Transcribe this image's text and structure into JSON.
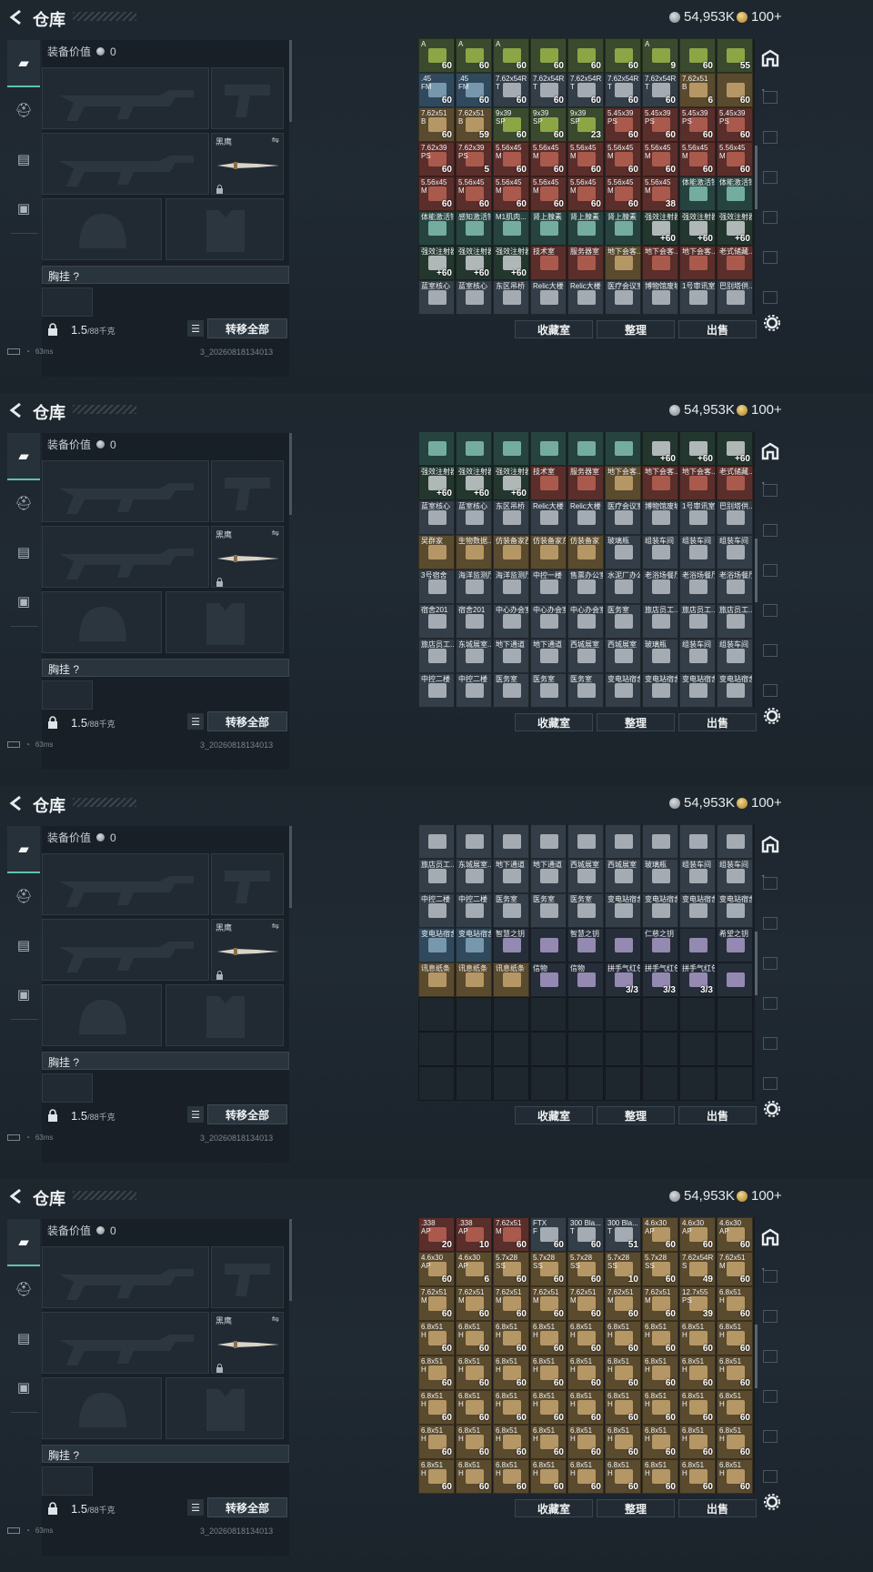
{
  "header": {
    "title": "仓库",
    "silver": "54,953K",
    "gold": "100+"
  },
  "loadout": {
    "value_label": "装备价值",
    "value": "0",
    "knife_label": "黑鹰",
    "chest_label": "胸挂 ?",
    "weight": "1.5",
    "weight_max": "/88千克",
    "move_all": "转移全部"
  },
  "buttons": {
    "collection": "收藏室",
    "organize": "整理",
    "sell": "出售"
  },
  "status": {
    "ping": "63ms",
    "build": "3_20260818134013"
  },
  "colors": {
    "ammo_blue": "#3a5b72",
    "ammo_tan": "#6b5a3a",
    "med_teal": "#2e5a52",
    "key_red": "#6b2a2e",
    "key_blue": "#2e3e6a",
    "key_tan": "#6a5634",
    "grey": "#3e4a55",
    "accent": "#5fc3a8"
  },
  "panels": [
    {
      "cells": [
        [
          "A|60|green",
          "A|60|green",
          "A|60|green",
          "|60|green",
          "|60|green",
          "|60|green",
          "A|9|green",
          "|60|green",
          "|55|green"
        ],
        [
          ".45\nFM|60|blue",
          ".45\nFM|60|blue",
          "7.62x54R\nT|60|grey",
          "7.62x54R\nT|60|grey",
          "7.62x54R\nT|60|grey",
          "7.62x54R\nT|60|grey",
          "7.62x54R\nT|60|grey",
          "7.62x51\nB|6|tan",
          "|60|tan"
        ],
        [
          "7.62x51\nB|60|tan",
          "7.62x51\nB|59|tan",
          "9x39\nSP|60|green",
          "9x39\nSP|60|green",
          "9x39\nSP|23|green",
          "5.45x39\nPS|60|red",
          "5.45x39\nPS|60|red",
          "5.45x39\nPS|60|red",
          "5.45x39\nPS|60|red"
        ],
        [
          "7.62x39\nPS|60|red",
          "7.62x39\nPS|5|red",
          "5.56x45\nM|60|red",
          "5.56x45\nM|60|red",
          "5.56x45\nM|60|red",
          "5.56x45\nM|60|red",
          "5.56x45\nM|60|red",
          "5.56x45\nM|60|red",
          "5.56x45\nM|60|red"
        ],
        [
          "5.56x45\nM|60|red",
          "5.56x45\nM|60|red",
          "5.56x45\nM|60|red",
          "5.56x45\nM|60|red",
          "5.56x45\nM|60|red",
          "5.56x45\nM|60|red",
          "5.56x45\nM|38|red",
          "体能激活针||teal",
          "体能激活针||teal"
        ],
        [
          "体能激活针||teal",
          "感知激活针||teal",
          "M1肌肉...||teal",
          "肾上腺素||teal",
          "肾上腺素||teal",
          "肾上腺素||teal",
          "强效注射器|+60|med",
          "强效注射器|+60|med",
          "强效注射器|+60|med"
        ],
        [
          "强效注射器|+60|med",
          "强效注射器|+60|med",
          "强效注射器|+60|med",
          "技术室||red",
          "服务器室||red",
          "地下会客...||tan",
          "地下会客...||red",
          "地下会客...||red",
          "老式储藏...||red"
        ],
        [
          "蓝室核心||grey",
          "蓝室核心||grey",
          "东区吊桥||grey",
          "Relic大楼||grey",
          "Relic大楼||grey",
          "医疗会议室||grey",
          "博物馆废墟||grey",
          "1号审讯室||grey",
          "巴别塔供...||grey"
        ]
      ]
    },
    {
      "cells": [
        [
          "||teal",
          "||teal",
          "||teal",
          "||teal",
          "||teal",
          "||teal",
          "|+60|med",
          "|+60|med",
          "|+60|med"
        ],
        [
          "强效注射器|+60|med",
          "强效注射器|+60|med",
          "强效注射器|+60|med",
          "技术室||red",
          "服务器室||red",
          "地下会客...||tan",
          "地下会客...||red",
          "地下会客...||red",
          "老式储藏...||red"
        ],
        [
          "蓝室核心||grey",
          "蓝室核心||grey",
          "东区吊桥||grey",
          "Relic大楼||grey",
          "Relic大楼||grey",
          "医疗会议室||grey",
          "博物馆废墟||grey",
          "1号审讯室||grey",
          "巴别塔供...||grey"
        ],
        [
          "吴群家||tan",
          "生物数据...||tan",
          "仿装备家西||tan",
          "仿装备家东||tan",
          "仿装备家||tan",
          "玻璃瓶||grey",
          "组装车间||grey",
          "组装车间||grey",
          "组装车间||grey"
        ],
        [
          "3号宿舍||grey",
          "海洋监测厅||grey",
          "海洋监测厅||grey",
          "中控一楼||grey",
          "售票办公室||grey",
          "水泥厂办公||grey",
          "老浴场餐厅||grey",
          "老浴场餐厅||grey",
          "老浴场餐厅||grey"
        ],
        [
          "宿舍201||grey",
          "宿舍201||grey",
          "中心办会室||grey",
          "中心办会室||grey",
          "中心办会室||grey",
          "医务室||grey",
          "旅店员工...||grey",
          "旅店员工...||grey",
          "旅店员工...||grey"
        ],
        [
          "旅店员工...||grey",
          "东城展室...||grey",
          "地下通道||grey",
          "地下通道||grey",
          "西城展室||grey",
          "西城展室||grey",
          "玻璃瓶||grey",
          "组装车间||grey",
          "组装车间||grey"
        ],
        [
          "中控二楼||grey",
          "中控二楼||grey",
          "医务室||grey",
          "医务室||grey",
          "医务室||grey",
          "变电站宿舍||grey",
          "变电站宿舍||grey",
          "变电站宿舍||grey",
          "变电站宿舍||grey"
        ]
      ]
    },
    {
      "cells": [
        [
          "||grey",
          "||grey",
          "||grey",
          "||grey",
          "||grey",
          "||grey",
          "||grey",
          "||grey",
          "||grey"
        ],
        [
          "旅店员工...||grey",
          "东城展室...||grey",
          "地下通道||grey",
          "地下通道||grey",
          "西城展室||grey",
          "西城展室||grey",
          "玻璃瓶||grey",
          "组装车间||grey",
          "组装车间||grey"
        ],
        [
          "中控二楼||grey",
          "中控二楼||grey",
          "医务室||grey",
          "医务室||grey",
          "医务室||grey",
          "变电站宿舍||grey",
          "变电站宿舍||grey",
          "变电站宿舍||grey",
          "变电站宿舍||grey"
        ],
        [
          "变电站宿舍||blue",
          "变电站宿舍||blue",
          "智慧之钥||dark",
          "||dark",
          "智慧之钥||dark",
          "||dark",
          "仁慈之钥||dark",
          "||dark",
          "希望之钥||dark"
        ],
        [
          "讯息纸条||tan",
          "讯息纸条||tan",
          "讯息纸条||tan",
          "信物||dark",
          "信物||dark",
          "拼手气红包|3/3|dark",
          "拼手气红包|3/3|dark",
          "拼手气红包|3/3|dark",
          "||dark"
        ],
        [
          "||empty",
          "||empty",
          "||empty",
          "||empty",
          "||empty",
          "||empty",
          "||empty",
          "||empty",
          "||empty"
        ],
        [
          "||empty",
          "||empty",
          "||empty",
          "||empty",
          "||empty",
          "||empty",
          "||empty",
          "||empty",
          "||empty"
        ],
        [
          "||empty",
          "||empty",
          "||empty",
          "||empty",
          "||empty",
          "||empty",
          "||empty",
          "||empty",
          "||empty"
        ]
      ]
    },
    {
      "cells": [
        [
          ".338\nAP|20|red",
          ".338\nAP|10|red",
          "7.62x51\nM|60|red",
          "FTX\nF|60|grey",
          "300 Bla...\nT|60|grey",
          "300 Bla...\nT|51|grey",
          "4.6x30\nAP|60|tan",
          "4.6x30\nAP|60|tan",
          "4.6x30\nAP|60|tan"
        ],
        [
          "4.6x30\nAP|60|tan",
          "4.6x30\nAP|6|tan",
          "5.7x28\nSS|60|tan",
          "5.7x28\nSS|60|tan",
          "5.7x28\nSS|60|tan",
          "5.7x28\nSS|10|tan",
          "5.7x28\nSS|60|tan",
          "7.62x54R\nS|49|tan",
          "7.62x51\nM|60|tan"
        ],
        [
          "7.62x51\nM|60|tan",
          "7.62x51\nM|60|tan",
          "7.62x51\nM|60|tan",
          "7.62x51\nM|60|tan",
          "7.62x51\nM|60|tan",
          "7.62x51\nM|60|tan",
          "7.62x51\nM|60|tan",
          "12.7x55\nPS|39|tan",
          "6.8x51\nH|60|tan"
        ],
        [
          "6.8x51\nH|60|tan",
          "6.8x51\nH|60|tan",
          "6.8x51\nH|60|tan",
          "6.8x51\nH|60|tan",
          "6.8x51\nH|60|tan",
          "6.8x51\nH|60|tan",
          "6.8x51\nH|60|tan",
          "6.8x51\nH|60|tan",
          "6.8x51\nH|60|tan"
        ],
        [
          "6.8x51\nH|60|tan",
          "6.8x51\nH|60|tan",
          "6.8x51\nH|60|tan",
          "6.8x51\nH|60|tan",
          "6.8x51\nH|60|tan",
          "6.8x51\nH|60|tan",
          "6.8x51\nH|60|tan",
          "6.8x51\nH|60|tan",
          "6.8x51\nH|60|tan"
        ],
        [
          "6.8x51\nH|60|tan",
          "6.8x51\nH|60|tan",
          "6.8x51\nH|60|tan",
          "6.8x51\nH|60|tan",
          "6.8x51\nH|60|tan",
          "6.8x51\nH|60|tan",
          "6.8x51\nH|60|tan",
          "6.8x51\nH|60|tan",
          "6.8x51\nH|60|tan"
        ],
        [
          "6.8x51\nH|60|tan",
          "6.8x51\nH|60|tan",
          "6.8x51\nH|60|tan",
          "6.8x51\nH|60|tan",
          "6.8x51\nH|60|tan",
          "6.8x51\nH|60|tan",
          "6.8x51\nH|60|tan",
          "6.8x51\nH|60|tan",
          "6.8x51\nH|60|tan"
        ],
        [
          "6.8x51\nH|60|tan",
          "6.8x51\nH|60|tan",
          "6.8x51\nH|60|tan",
          "6.8x51\nH|60|tan",
          "6.8x51\nH|60|tan",
          "6.8x51\nH|60|tan",
          "6.8x51\nH|60|tan",
          "6.8x51\nH|60|tan",
          "6.8x51\nH|60|tan"
        ]
      ]
    }
  ]
}
